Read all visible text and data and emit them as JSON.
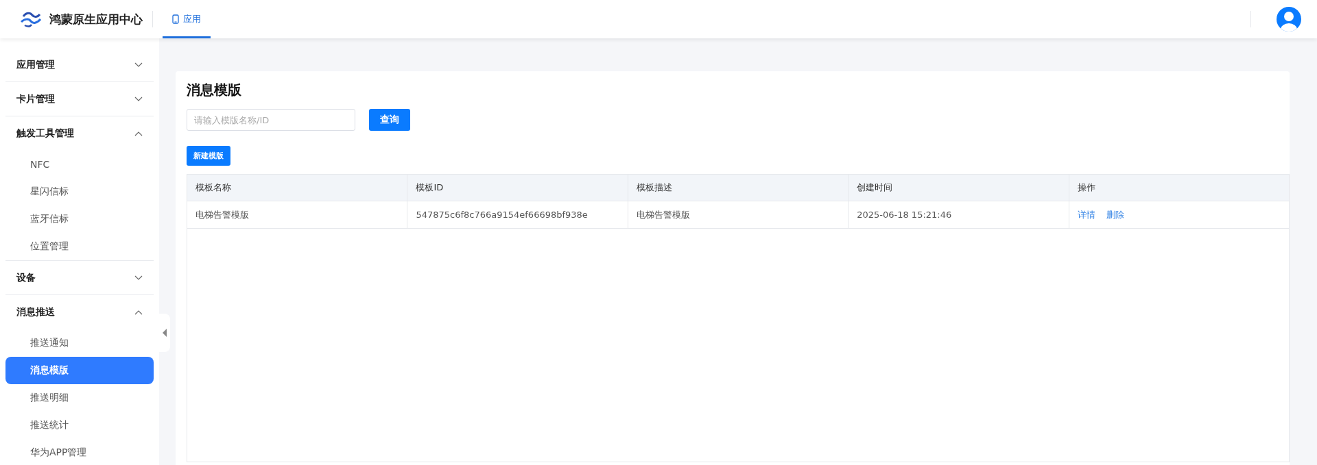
{
  "header": {
    "app_name": "鸿蒙原生应用中心",
    "tabs": [
      {
        "label": "应用",
        "selected": true
      }
    ]
  },
  "sidebar": {
    "groups": [
      {
        "label": "应用管理",
        "expanded": false
      },
      {
        "label": "卡片管理",
        "expanded": false
      },
      {
        "label": "触发工具管理",
        "expanded": true,
        "children": [
          {
            "label": "NFC",
            "selected": false
          },
          {
            "label": "星闪信标",
            "selected": false
          },
          {
            "label": "蓝牙信标",
            "selected": false
          },
          {
            "label": "位置管理",
            "selected": false
          }
        ]
      },
      {
        "label": "设备",
        "expanded": false
      },
      {
        "label": "消息推送",
        "expanded": true,
        "children": [
          {
            "label": "推送通知",
            "selected": false
          },
          {
            "label": "消息模版",
            "selected": true
          },
          {
            "label": "推送明细",
            "selected": false
          },
          {
            "label": "推送统计",
            "selected": false
          },
          {
            "label": "华为APP管理",
            "selected": false
          }
        ]
      }
    ]
  },
  "page": {
    "title": "消息模版",
    "search": {
      "placeholder": "请输入模版名称/ID"
    },
    "search_button": "查询",
    "new_button": "新建模版",
    "table": {
      "columns": [
        "模板名称",
        "模板ID",
        "模板描述",
        "创建时间",
        "操作"
      ],
      "rows": [
        {
          "cells": [
            "电梯告警模版",
            "547875c6f8c766a9154ef66698bf938e",
            "电梯告警模版",
            "2025-06-18 15:21:46"
          ],
          "actions": [
            "详情",
            "删除"
          ]
        }
      ]
    }
  }
}
